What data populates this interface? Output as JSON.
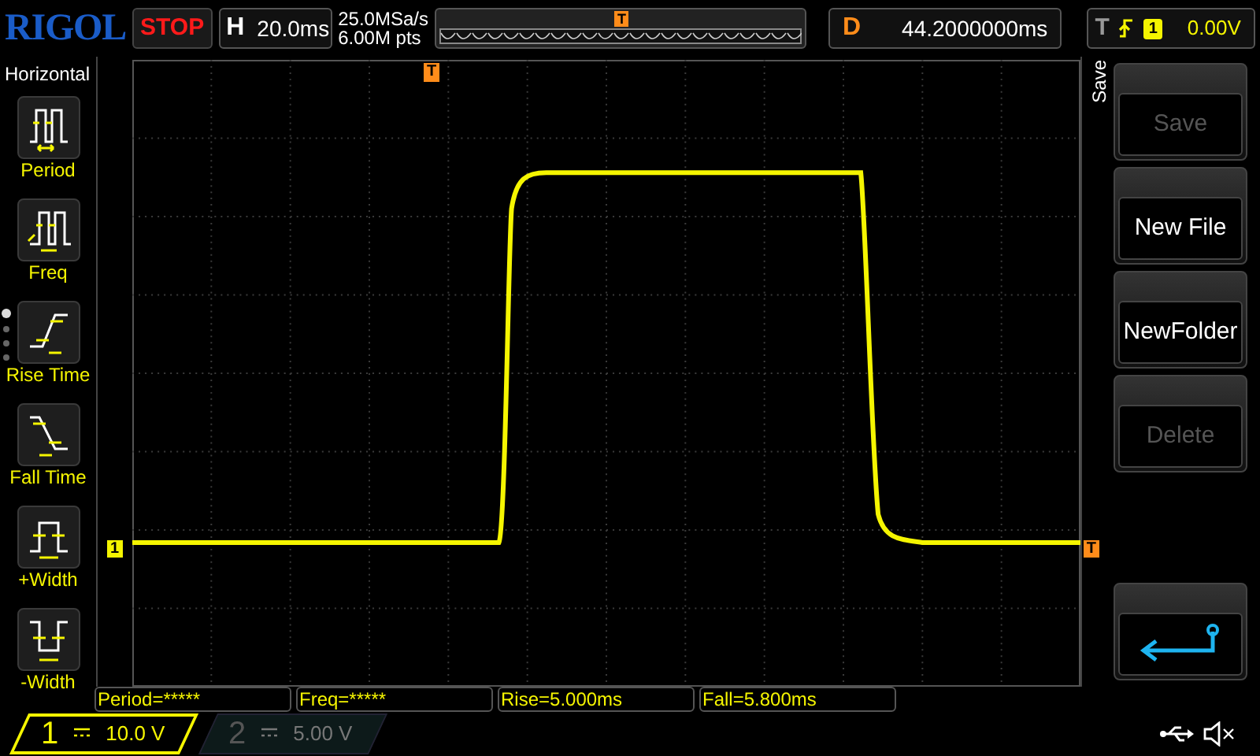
{
  "header": {
    "logo": "RIGOL",
    "run_state": "STOP",
    "timebase": {
      "label": "H",
      "value": "20.0ms"
    },
    "sample_rate": "25.0MSa/s",
    "memory_depth": "6.00M pts",
    "memory_trigger_marker": "T",
    "delay": {
      "label": "D",
      "value": "44.2000000ms"
    },
    "trigger": {
      "label": "T",
      "source": "1",
      "level": "0.00V"
    }
  },
  "measure_menu": {
    "title": "Horizontal",
    "items": [
      {
        "label": "Period",
        "kind": "period"
      },
      {
        "label": "Freq",
        "kind": "freq"
      },
      {
        "label": "Rise Time",
        "kind": "rise"
      },
      {
        "label": "Fall Time",
        "kind": "fall"
      },
      {
        "label": "+Width",
        "kind": "pwidth"
      },
      {
        "label": "-Width",
        "kind": "nwidth"
      }
    ],
    "pages": [
      {
        "selected": true
      },
      {
        "selected": false
      },
      {
        "selected": false
      },
      {
        "selected": false
      }
    ]
  },
  "display": {
    "top_trigger_marker": "T",
    "channel_marker": "1",
    "trigger_level_marker": "T"
  },
  "softkey_menu": {
    "title": "Save",
    "buttons": [
      {
        "kind": "text",
        "label": "Save",
        "disabled": true
      },
      {
        "kind": "text",
        "label": "New File",
        "disabled": false
      },
      {
        "kind": "text",
        "label": "NewFolder",
        "disabled": false
      },
      {
        "kind": "text",
        "label": "Delete",
        "disabled": true
      },
      {
        "kind": "back"
      }
    ]
  },
  "measurements": [
    "Period=*****",
    "Freq=*****",
    "Rise=5.000ms",
    "Fall=5.800ms"
  ],
  "channels": [
    {
      "number": "1",
      "scale": "10.0 V",
      "active": true
    },
    {
      "number": "2",
      "scale": "5.00 V",
      "active": false
    }
  ]
}
